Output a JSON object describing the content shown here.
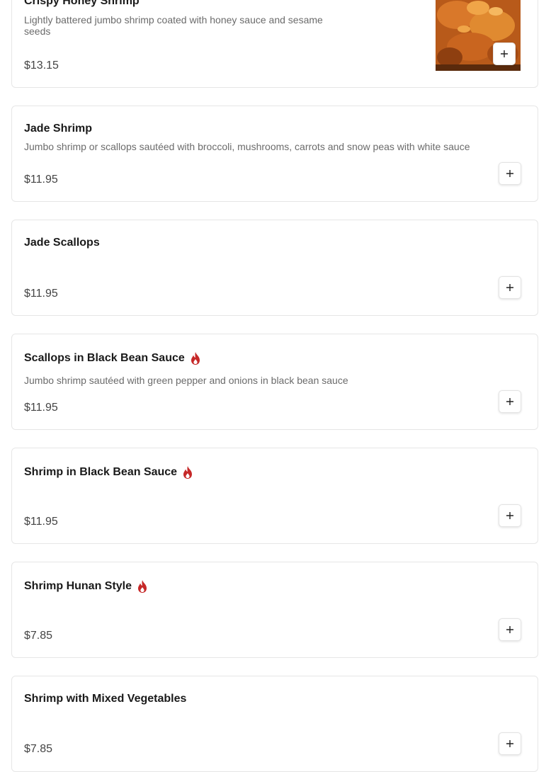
{
  "items": [
    {
      "name": "Crispy Honey Shrimp",
      "description": "Lightly battered jumbo shrimp coated with honey sauce and sesame seeds",
      "price": "$13.15",
      "spicy": false,
      "has_image": true
    },
    {
      "name": "Jade Shrimp",
      "description": "Jumbo shrimp or scallops sautéed with broccoli, mushrooms, carrots and snow peas with white sauce",
      "price": "$11.95",
      "spicy": false
    },
    {
      "name": "Jade Scallops",
      "description": "",
      "price": "$11.95",
      "spicy": false
    },
    {
      "name": "Scallops in Black Bean Sauce",
      "description": "Jumbo shrimp sautéed with green pepper and onions in black bean sauce",
      "price": "$11.95",
      "spicy": true
    },
    {
      "name": "Shrimp in Black Bean Sauce",
      "description": "",
      "price": "$11.95",
      "spicy": true
    },
    {
      "name": "Shrimp Hunan Style",
      "description": "",
      "price": "$7.85",
      "spicy": true
    },
    {
      "name": "Shrimp with Mixed Vegetables",
      "description": "",
      "price": "$7.85",
      "spicy": false
    }
  ],
  "icons": {
    "add": "plus-icon",
    "spicy": "flame-icon"
  },
  "colors": {
    "spicy": "#c62828",
    "border": "#e6e6e6",
    "price": "#444444",
    "description": "#6b6b6b"
  }
}
